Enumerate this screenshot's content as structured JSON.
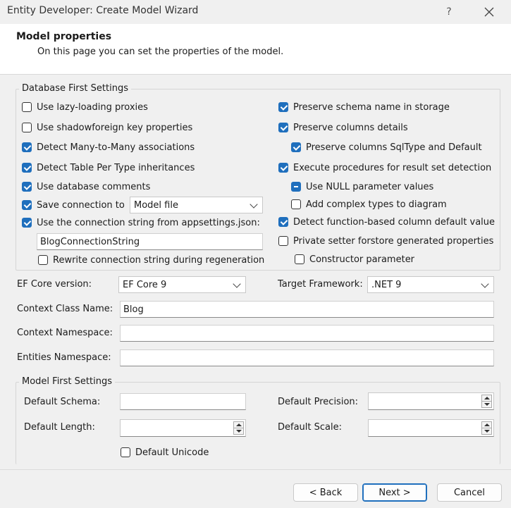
{
  "window": {
    "title": "Entity Developer: Create Model Wizard",
    "help_glyph": "?"
  },
  "header": {
    "title": "Model properties",
    "subtitle": "On this page you can set the properties of the model."
  },
  "db_first": {
    "legend": "Database First Settings",
    "lazy_loading": "Use lazy-loading proxies",
    "shadow_fk": "Use shadowforeign key properties",
    "many_to_many": "Detect Many-to-Many associations",
    "tpt": "Detect Table Per Type inheritances",
    "db_comments": "Use database comments",
    "save_conn": "Save connection to",
    "save_conn_value": "Model file",
    "use_appsettings": "Use the connection string from appsettings.json:",
    "conn_string_name": "BlogConnectionString",
    "rewrite_conn": "Rewrite connection string during regeneration",
    "preserve_schema": "Preserve schema name in storage",
    "preserve_columns": "Preserve columns details",
    "preserve_sqltype": "Preserve columns SqlType and Default",
    "exec_procs": "Execute procedures for result set detection",
    "use_null": "Use NULL parameter values",
    "add_complex": "Add complex types to diagram",
    "detect_func_default": "Detect function-based column default value",
    "private_setter": "Private setter forstore generated properties",
    "ctor_param": "Constructor parameter"
  },
  "general": {
    "ef_core_label": "EF Core version:",
    "ef_core_value": "EF Core 9",
    "target_fw_label": "Target Framework:",
    "target_fw_value": ".NET 9",
    "ctx_class_label": "Context Class Name:",
    "ctx_class_value": "Blog",
    "ctx_ns_label": "Context Namespace:",
    "ctx_ns_value": "",
    "ent_ns_label": "Entities Namespace:",
    "ent_ns_value": ""
  },
  "model_first": {
    "legend": "Model First Settings",
    "default_schema": "Default Schema:",
    "default_length": "Default Length:",
    "default_precision": "Default Precision:",
    "default_scale": "Default Scale:",
    "default_unicode": "Default Unicode"
  },
  "footer": {
    "back": "< Back",
    "next": "Next >",
    "cancel": "Cancel"
  },
  "colors": {
    "accent": "#1f6fbd",
    "window_bg": "#f0f0f0"
  }
}
